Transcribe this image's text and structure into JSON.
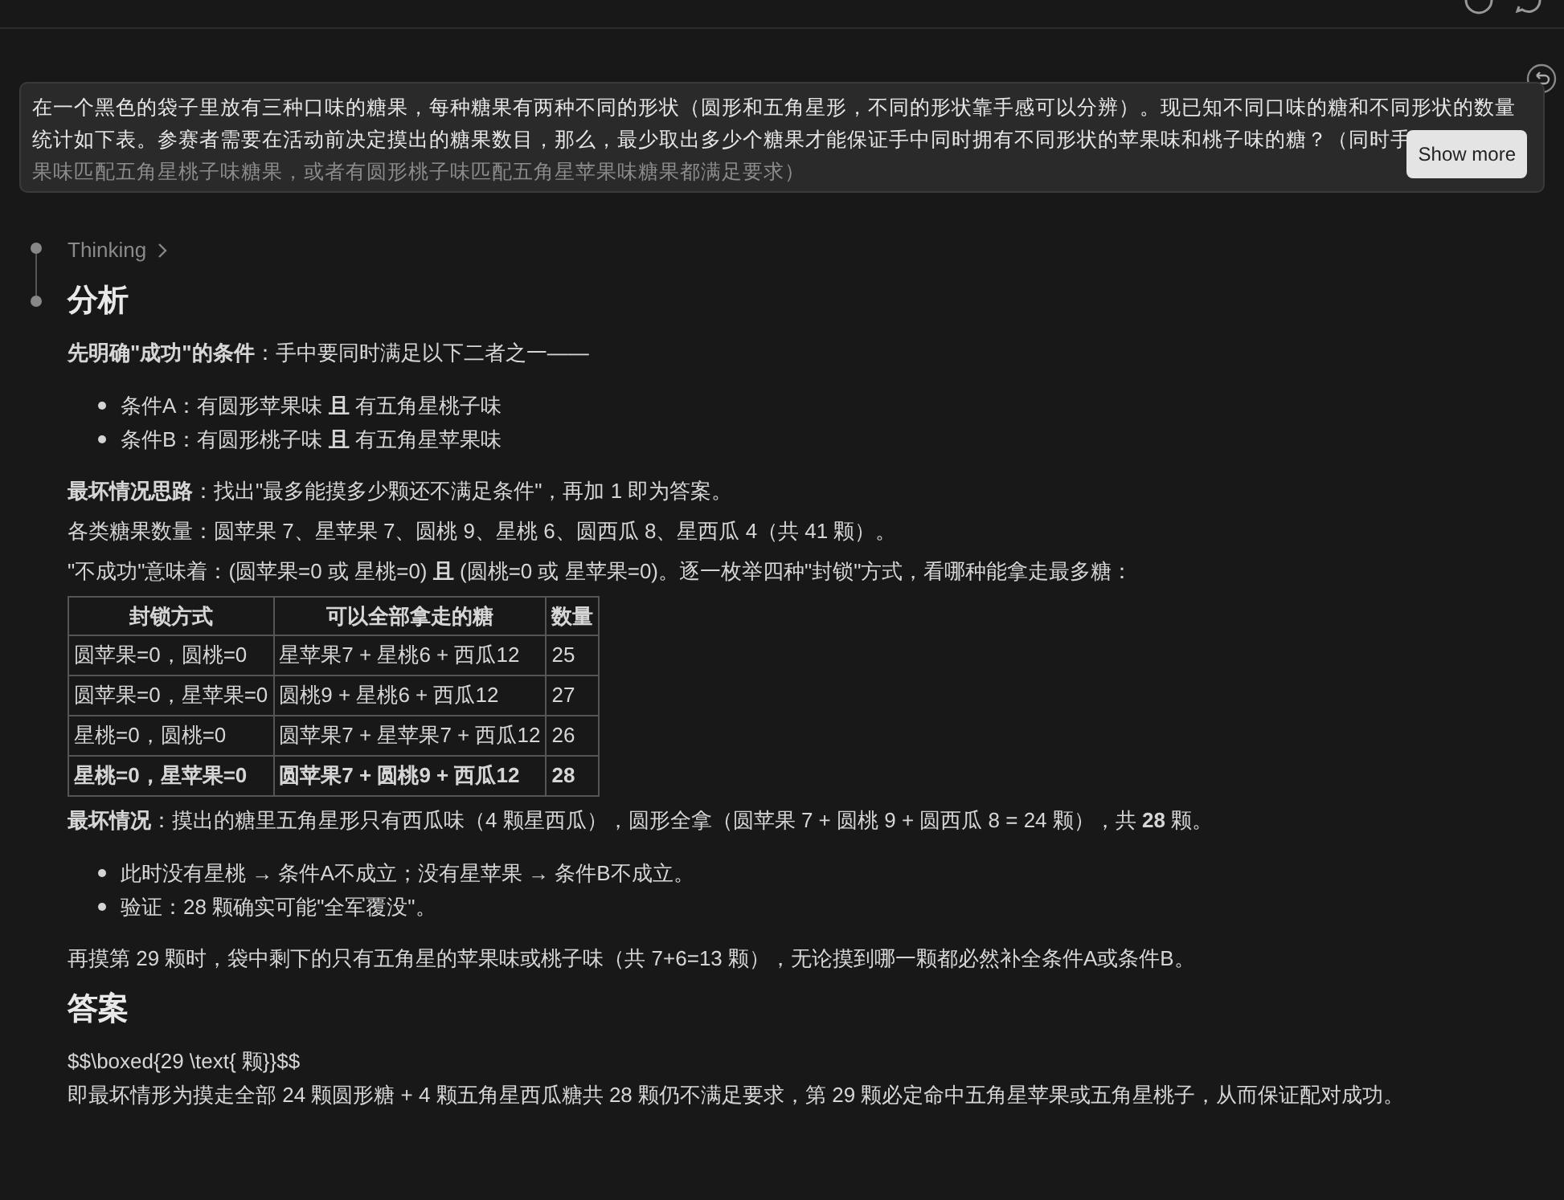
{
  "prompt": {
    "lines": [
      "在一个黑色的袋子里放有三种口味的糖果，每种糖果有两种不同的形状（圆形和五角星形，不同的形状靠手感可以分辨）。现已知不同口味的糖和不同形状的数量",
      "统计如下表。参赛者需要在活动前决定摸出的糖果数目，那么，最少取出多少个糖果才能保证手中同时拥有不同形状的苹果味和桃子味的糖？（同时手",
      "果味匹配五角星桃子味糖果，或者有圆形桃子味匹配五角星苹果味糖果都满足要求）"
    ],
    "button": "Show more"
  },
  "thinking": {
    "label": "Thinking",
    "expanded": false
  },
  "blocks": [
    {
      "kind": "heading",
      "text": "分析"
    },
    {
      "kind": "para",
      "text": "**先明确\"成功\"的条件**：手中要同时满足以下二者之一——"
    },
    {
      "kind": "list",
      "items": [
        "条件A：有圆形苹果味 **且** 有五角星桃子味",
        "条件B：有圆形桃子味 **且** 有五角星苹果味"
      ]
    },
    {
      "kind": "para",
      "text": "**最坏情况思路**：找出\"最多能摸多少颗还不满足条件\"，再加 1 即为答案。"
    },
    {
      "kind": "para",
      "text": "各类糖果数量：圆苹果 7、星苹果 7、圆桃 9、星桃 6、圆西瓜 8、星西瓜 4（共 41 颗）。"
    },
    {
      "kind": "para",
      "text": "\"不成功\"意味着：(圆苹果=0 或 星桃=0) **且** (圆桃=0 或 星苹果=0)。逐一枚举四种\"封锁\"方式，看哪种能拿走最多糖："
    },
    {
      "kind": "table",
      "columns": [
        "封锁方式",
        "可以全部拿走的糖",
        "数量"
      ],
      "rows": [
        {
          "bold": false,
          "cells": [
            "圆苹果=0，圆桃=0",
            "星苹果7 + 星桃6 + 西瓜12",
            "25"
          ]
        },
        {
          "bold": false,
          "cells": [
            "圆苹果=0，星苹果=0",
            "圆桃9 + 星桃6 + 西瓜12",
            "27"
          ]
        },
        {
          "bold": false,
          "cells": [
            "星桃=0，圆桃=0",
            "圆苹果7 + 星苹果7 + 西瓜12",
            "26"
          ]
        },
        {
          "bold": true,
          "cells": [
            "星桃=0，星苹果=0",
            "圆苹果7 + 圆桃9 + 西瓜12",
            "28"
          ]
        }
      ]
    },
    {
      "kind": "para",
      "text": "**最坏情况**：摸出的糖里五角星形只有西瓜味（4 颗星西瓜），圆形全拿（圆苹果 7 + 圆桃 9 + 圆西瓜 8 = 24 颗），共 **28** 颗。"
    },
    {
      "kind": "list",
      "items": [
        "此时没有星桃 → 条件A不成立；没有星苹果 → 条件B不成立。",
        "验证：28 颗确实可能\"全军覆没\"。"
      ]
    },
    {
      "kind": "para",
      "text": "再摸第 29 颗时，袋中剩下的只有五角星的苹果味或桃子味（共 7+6=13 颗），无论摸到哪一颗都必然补全条件A或条件B。"
    },
    {
      "kind": "heading",
      "text": "答案"
    },
    {
      "kind": "para",
      "text": "$$\\boxed{29 \\text{ 颗}}$$"
    },
    {
      "kind": "tight",
      "text": "即最坏情形为摸走全部 24 颗圆形糖 + 4 颗五角星西瓜糖共 28 颗仍不满足要求，第 29 颗必定命中五角星苹果或五角星桃子，从而保证配对成功。"
    }
  ]
}
